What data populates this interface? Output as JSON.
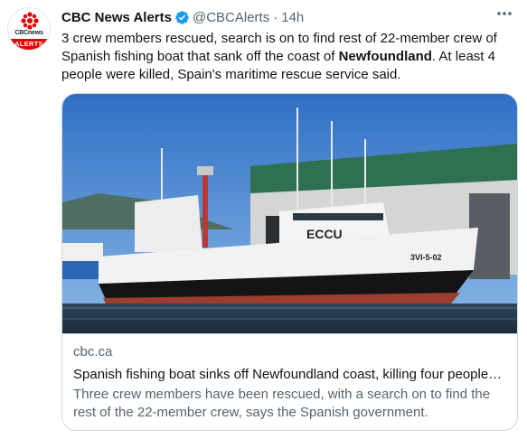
{
  "author": {
    "name": "CBC News Alerts",
    "handle": "@CBCAlerts",
    "separator": "·",
    "time": "14h",
    "avatar": {
      "logo_text": "CBCnews",
      "band_text": "ALERTS",
      "brand_color": "#e60000"
    },
    "verified_color": "#1d9bf0"
  },
  "more_icon": "more-horizontal-icon",
  "tweet": {
    "text_before": "3 crew members rescued, search is on to find rest of 22-member crew of Spanish fishing boat that sank off the coast of ",
    "bold_word": "Newfoundland",
    "text_after": ". At least 4 people were killed, Spain's maritime rescue service said."
  },
  "card": {
    "image_alt": "Spanish fishing boat docked at a harbour",
    "domain": "cbc.ca",
    "title": "Spanish fishing boat sinks off Newfoundland coast, killing four people…",
    "description": "Three crew members have been rescued, with a search on to find the rest of the 22-member crew, says the Spanish government."
  },
  "image_content": {
    "ship_call_sign": "ECCU",
    "hull_marking": "3VI-5-02"
  }
}
